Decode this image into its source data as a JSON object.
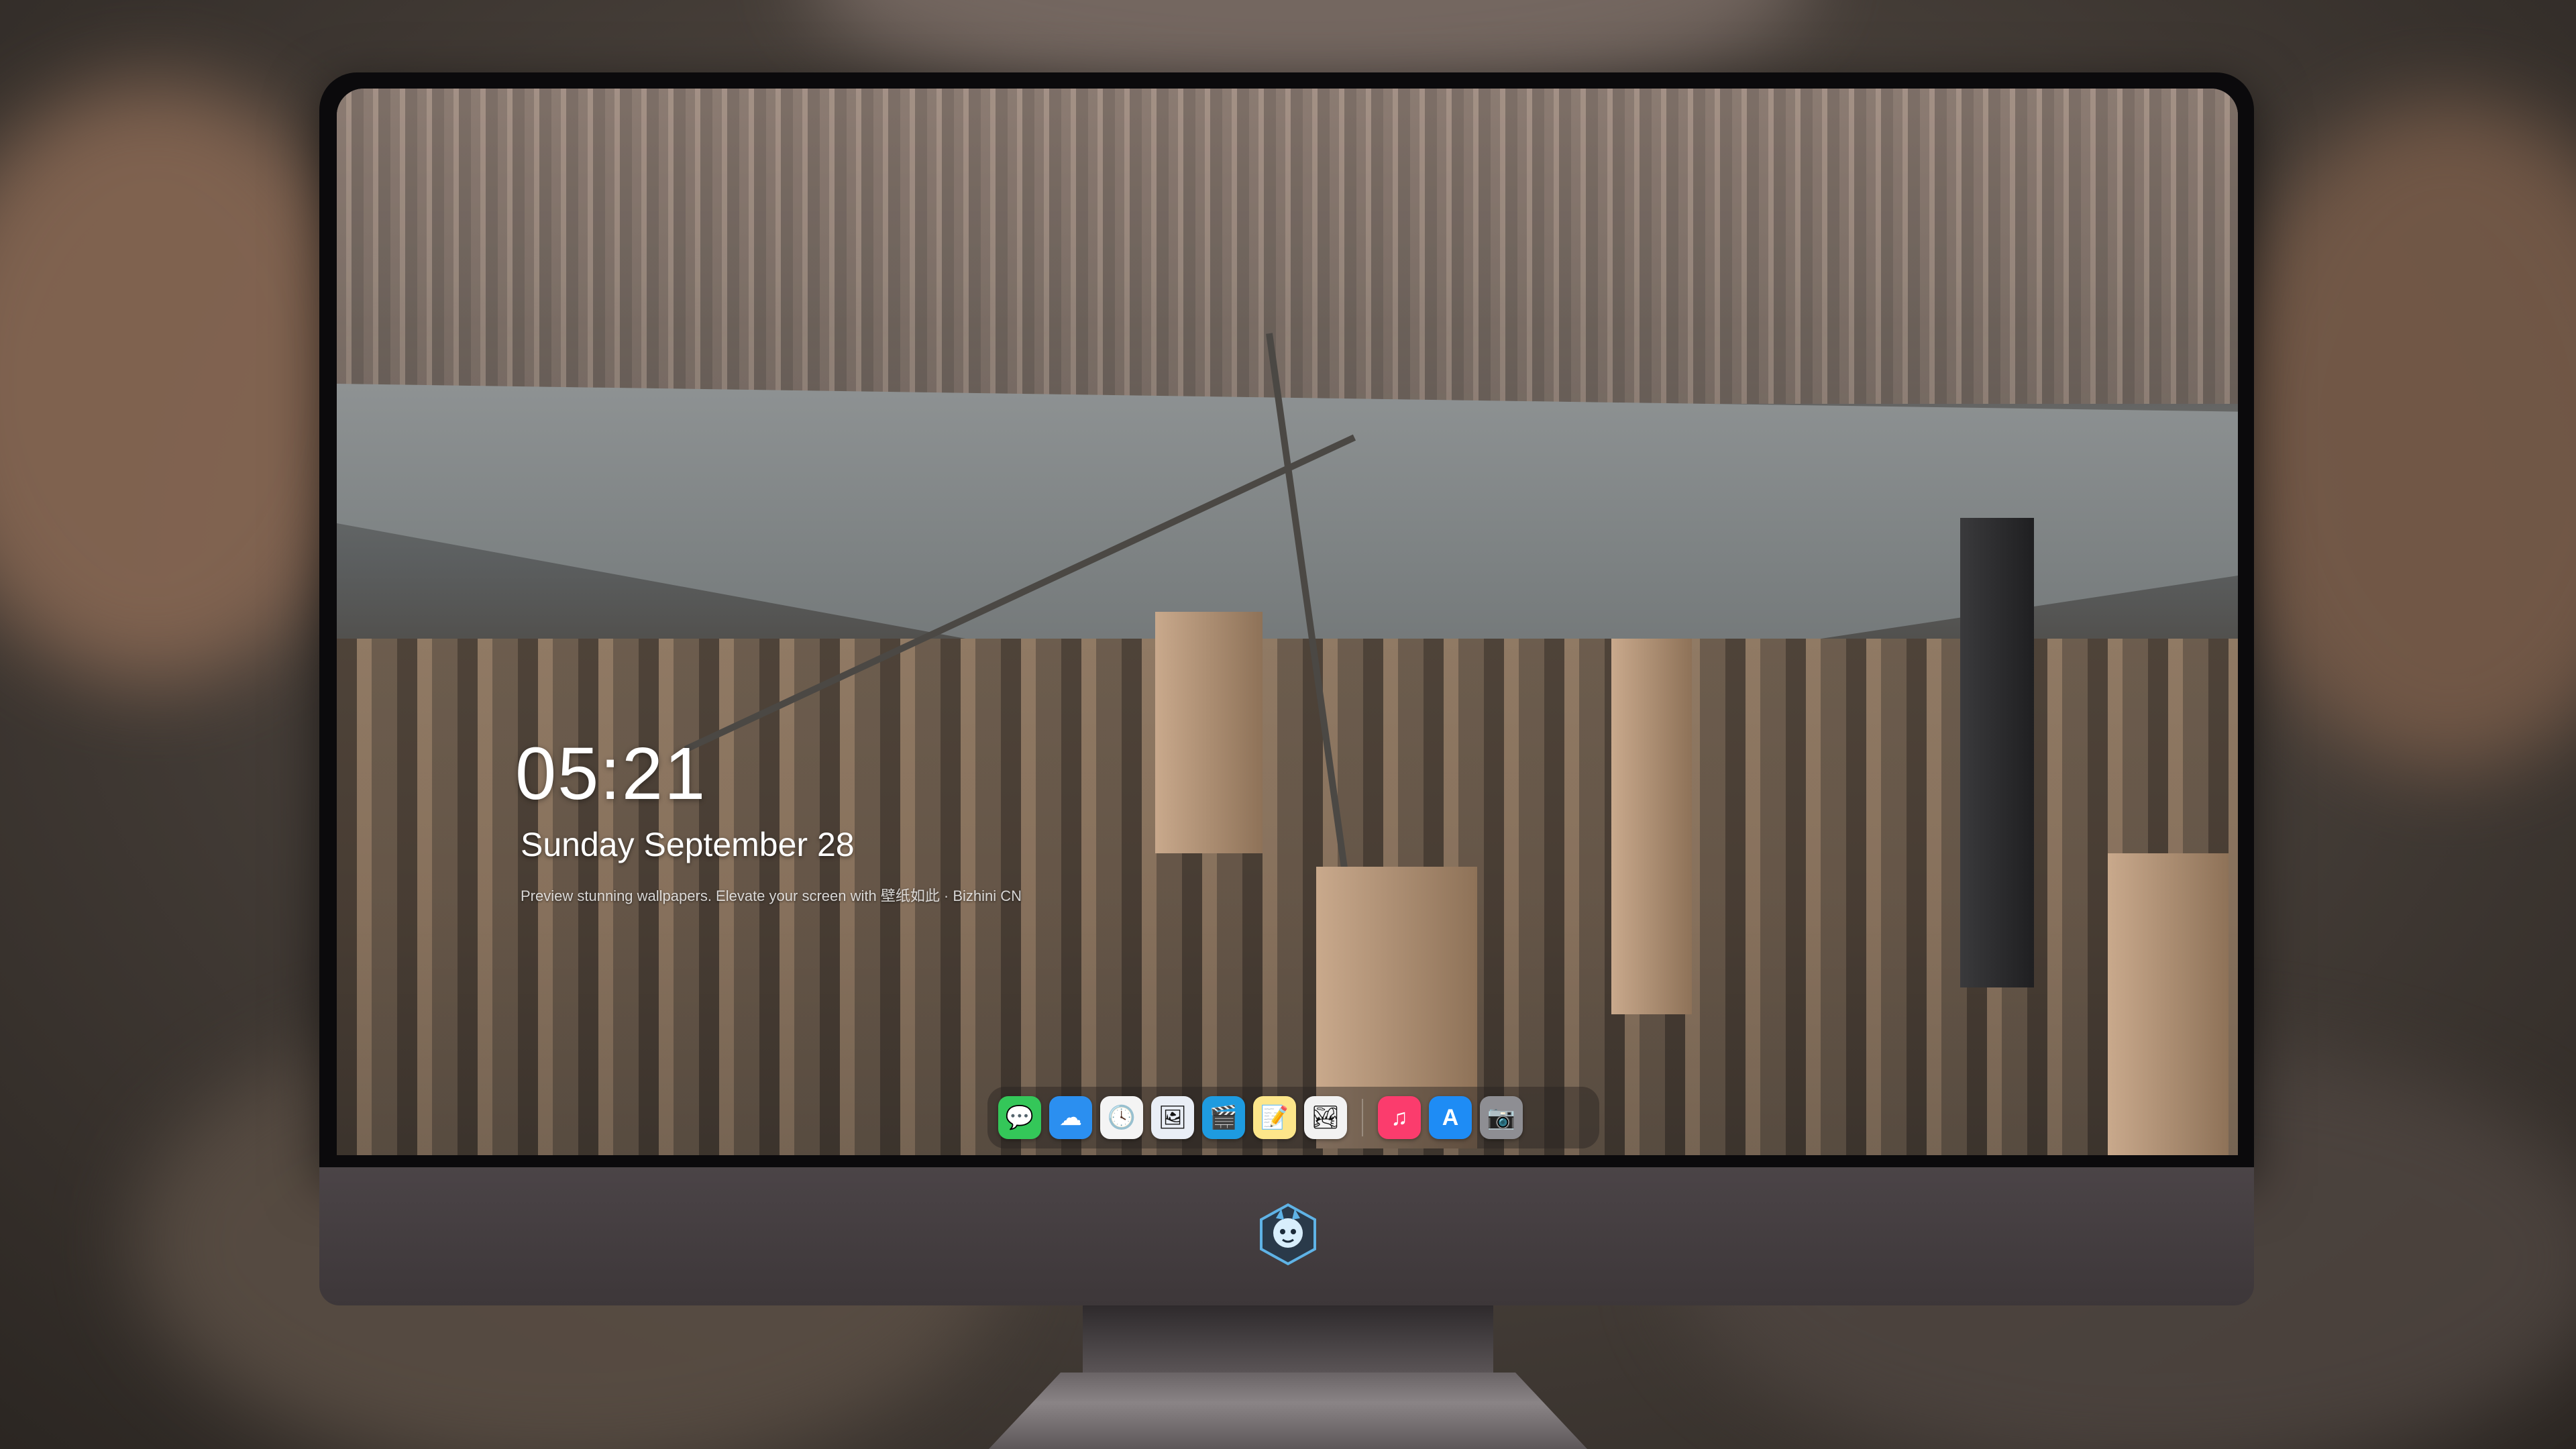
{
  "lockscreen": {
    "time": "05:21",
    "date": "Sunday September 28",
    "caption": "Preview stunning wallpapers. Elevate your screen with 壁纸如此 · Bizhini CN"
  },
  "dock": {
    "apps": [
      {
        "name": "Messages",
        "icon": "messages-icon",
        "glyph": "💬",
        "color": "#34c759"
      },
      {
        "name": "Weather",
        "icon": "weather-icon",
        "glyph": "☁",
        "color": "#2b8ff0"
      },
      {
        "name": "Clock",
        "icon": "clock-icon",
        "glyph": "🕓",
        "color": "#f4f4f4"
      },
      {
        "name": "Preview",
        "icon": "preview-icon",
        "glyph": "🖼",
        "color": "#e9eef6"
      },
      {
        "name": "Clips",
        "icon": "clips-icon",
        "glyph": "🎬",
        "color": "#1e9be0"
      },
      {
        "name": "Notes",
        "icon": "notes-icon",
        "glyph": "📝",
        "color": "#fde68a"
      },
      {
        "name": "Photos",
        "icon": "photos-icon",
        "glyph": "🏞",
        "color": "#f2f2f2"
      },
      {
        "name": "Music",
        "icon": "music-icon",
        "glyph": "♫",
        "color": "#fb3c6d"
      },
      {
        "name": "App Store",
        "icon": "app-store-icon",
        "glyph": "A",
        "color": "#1e8cf5"
      },
      {
        "name": "Camera",
        "icon": "camera-icon",
        "glyph": "📷",
        "color": "#8e8e93"
      }
    ]
  },
  "monitor": {
    "logo": "mascot-logo-icon"
  }
}
